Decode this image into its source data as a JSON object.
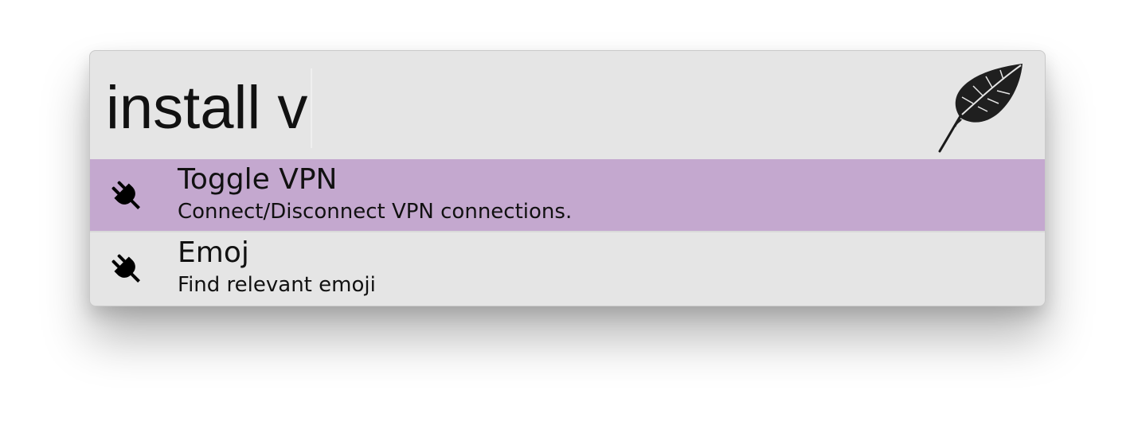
{
  "search": {
    "query": "install v"
  },
  "app": {
    "logo_icon": "feather-icon"
  },
  "results": [
    {
      "title": "Toggle VPN",
      "subtitle": "Connect/Disconnect VPN connections.",
      "icon": "plug-icon",
      "selected": true
    },
    {
      "title": "Emoj",
      "subtitle": "Find relevant emoji",
      "icon": "plug-icon",
      "selected": false
    }
  ],
  "colors": {
    "window_background": "#e5e5e5",
    "selection": "#c4a8cf",
    "text": "#111111"
  }
}
